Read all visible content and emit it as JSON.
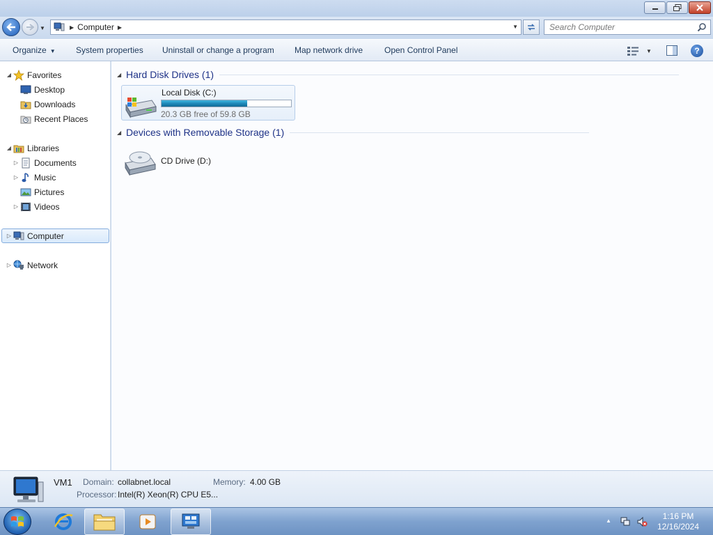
{
  "window": {
    "controls": {
      "minimize_icon": "minimize-icon",
      "maximize_icon": "restore-icon",
      "close_icon": "close-icon"
    }
  },
  "address_bar": {
    "crumbs": [
      "Computer"
    ],
    "search_placeholder": "Search Computer"
  },
  "toolbar": {
    "organize_label": "Organize",
    "system_properties_label": "System properties",
    "uninstall_label": "Uninstall or change a program",
    "map_drive_label": "Map network drive",
    "control_panel_label": "Open Control Panel"
  },
  "nav": {
    "favorites": {
      "label": "Favorites",
      "items": [
        "Desktop",
        "Downloads",
        "Recent Places"
      ]
    },
    "libraries": {
      "label": "Libraries",
      "items": [
        "Documents",
        "Music",
        "Pictures",
        "Videos"
      ]
    },
    "computer_label": "Computer",
    "network_label": "Network"
  },
  "groups": {
    "hard_disks": {
      "title": "Hard Disk Drives (1)",
      "drives": [
        {
          "name": "Local Disk (C:)",
          "free_text": "20.3 GB free of 59.8 GB",
          "used_fraction": 0.66
        }
      ]
    },
    "removable": {
      "title": "Devices with Removable Storage (1)",
      "drives": [
        {
          "name": "CD Drive (D:)"
        }
      ]
    }
  },
  "details": {
    "name": "VM1",
    "domain_label": "Domain:",
    "domain_value": "collabnet.local",
    "memory_label": "Memory:",
    "memory_value": "4.00 GB",
    "processor_label": "Processor:",
    "processor_value": "Intel(R) Xeon(R) CPU E5..."
  },
  "taskbar": {
    "time": "1:16 PM",
    "date": "12/16/2024"
  },
  "colors": {
    "accent": "#1e3287",
    "capacity_fill": "#1b86b6",
    "selection_border": "#84acdd"
  }
}
